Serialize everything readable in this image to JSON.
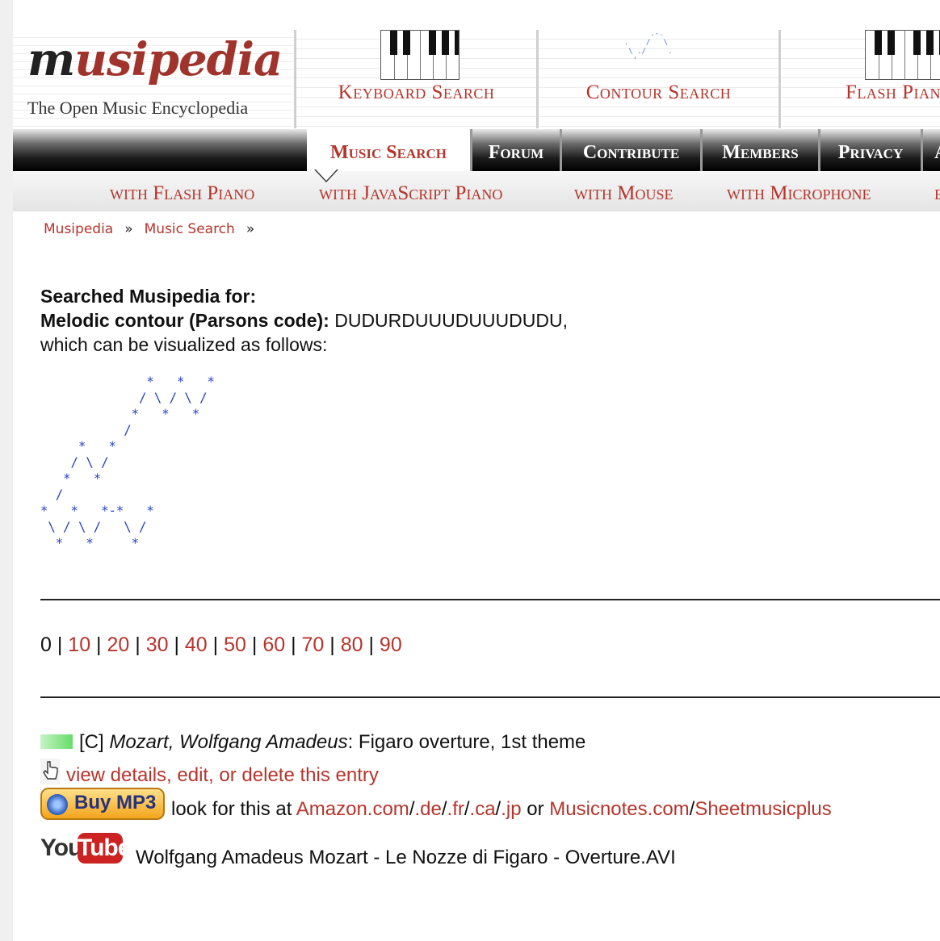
{
  "logo": {
    "initial": "m",
    "rest": "usipedia",
    "subtitle": "The Open Music Encyclopedia"
  },
  "header_tabs": [
    {
      "label": "Keyboard Search",
      "icon": "piano-keys-icon"
    },
    {
      "label": "Contour Search",
      "icon": "contour-icon"
    },
    {
      "label": "Flash Piano",
      "icon": "piano-keys-icon"
    }
  ],
  "contour_icon_text": "        .-.\n  .    /   \\\n   \\ ./     .\n    '",
  "nav": {
    "tabs": [
      "Music Search",
      "Forum",
      "Contribute",
      "Members",
      "Privacy",
      "About"
    ],
    "active": "Music Search",
    "sub": [
      "with Flash Piano",
      "with JavaScript Piano",
      "with Mouse",
      "with Microphone",
      "by"
    ]
  },
  "breadcrumb": {
    "items": [
      "Musipedia",
      "Music Search"
    ],
    "separator": "»"
  },
  "search": {
    "heading": "Searched Musipedia for:",
    "contour_label": "Melodic contour (Parsons code):",
    "contour_value": " DUDURDUUUDUUUDUDU,",
    "visual_text": "which can be visualized as follows:",
    "ascii": "              *   *   *\n             / \\ / \\ /\n            *   *   *\n           /\n     *   *\n    / \\ /\n   *   *\n  /\n*   *   *-*   *\n \\ / \\ /   \\ /\n  *   *     *"
  },
  "pager": {
    "current": "0",
    "links": [
      "10",
      "20",
      "30",
      "40",
      "50",
      "60",
      "70",
      "80",
      "90"
    ],
    "separator": " | "
  },
  "result": {
    "key": "[C]",
    "composer": "Mozart, Wolfgang Amadeus",
    "title": ": Figaro overture, 1st theme",
    "details_link": "view details, edit, or delete this entry",
    "buy_label": "Buy MP3",
    "look_text": "look for this at ",
    "stores": {
      "amazon": "Amazon.com",
      "de": ".de",
      "fr": ".fr",
      "ca": ".ca",
      "jp": ".jp",
      "or": " or ",
      "musicnotes": "Musicnotes.com",
      "slash": "/",
      "sheetmusicplus": "Sheetmusicplus"
    },
    "youtube": {
      "you": "You",
      "tube": "Tube",
      "title": "Wolfgang Amadeus Mozart - Le Nozze di Figaro - Overture.AVI"
    }
  },
  "colors": {
    "link": "#b5352c",
    "ascii": "#2342c4",
    "nav_dark": "#000000"
  }
}
